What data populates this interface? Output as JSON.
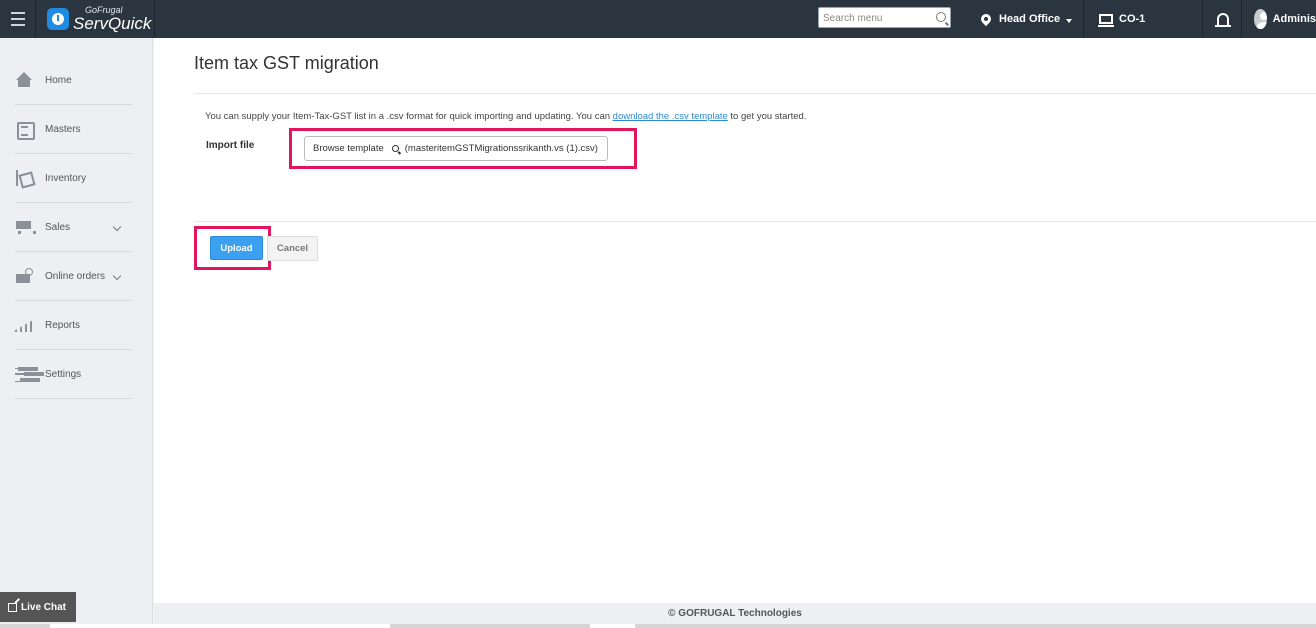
{
  "brand": {
    "top": "GoFrugal",
    "name": "ServQuick",
    "color": "#1f8be0"
  },
  "topbar": {
    "search_placeholder": "Search menu",
    "location": "Head Office",
    "counter": "CO-1",
    "user": "Adminis"
  },
  "sidebar": {
    "items": [
      {
        "label": "Home",
        "icon": "home-icon"
      },
      {
        "label": "Masters",
        "icon": "masters-icon"
      },
      {
        "label": "Inventory",
        "icon": "inventory-icon"
      },
      {
        "label": "Sales",
        "icon": "cart-icon",
        "expandable": true
      },
      {
        "label": "Online orders",
        "icon": "online-orders-icon",
        "expandable": true
      },
      {
        "label": "Reports",
        "icon": "reports-icon"
      },
      {
        "label": "Settings",
        "icon": "settings-icon"
      }
    ]
  },
  "main": {
    "title": "Item tax GST migration",
    "info_prefix": "You can supply your Item-Tax-GST list in a .csv format for quick importing and updating. You can ",
    "info_link": "download the .csv template",
    "info_suffix": " to get you started.",
    "import_label": "Import file",
    "browse_label": "Browse template",
    "file_name": "(masteritemGSTMigrationssrikanth.vs (1).csv)",
    "upload_label": "Upload",
    "cancel_label": "Cancel",
    "highlight_color": "#e0155e",
    "upload_color": "#3ba0ef"
  },
  "footer": {
    "copyright": "© GOFRUGAL Technologies"
  },
  "livechat": {
    "label": "Live Chat"
  }
}
